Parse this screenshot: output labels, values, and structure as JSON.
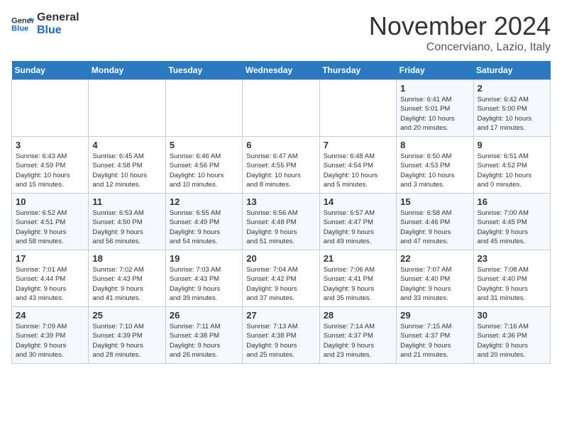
{
  "header": {
    "logo_line1": "General",
    "logo_line2": "Blue",
    "month": "November 2024",
    "location": "Concerviano, Lazio, Italy"
  },
  "days_of_week": [
    "Sunday",
    "Monday",
    "Tuesday",
    "Wednesday",
    "Thursday",
    "Friday",
    "Saturday"
  ],
  "weeks": [
    [
      {
        "day": "",
        "info": ""
      },
      {
        "day": "",
        "info": ""
      },
      {
        "day": "",
        "info": ""
      },
      {
        "day": "",
        "info": ""
      },
      {
        "day": "",
        "info": ""
      },
      {
        "day": "1",
        "info": "Sunrise: 6:41 AM\nSunset: 5:01 PM\nDaylight: 10 hours\nand 20 minutes."
      },
      {
        "day": "2",
        "info": "Sunrise: 6:42 AM\nSunset: 5:00 PM\nDaylight: 10 hours\nand 17 minutes."
      }
    ],
    [
      {
        "day": "3",
        "info": "Sunrise: 6:43 AM\nSunset: 4:59 PM\nDaylight: 10 hours\nand 15 minutes."
      },
      {
        "day": "4",
        "info": "Sunrise: 6:45 AM\nSunset: 4:58 PM\nDaylight: 10 hours\nand 12 minutes."
      },
      {
        "day": "5",
        "info": "Sunrise: 6:46 AM\nSunset: 4:56 PM\nDaylight: 10 hours\nand 10 minutes."
      },
      {
        "day": "6",
        "info": "Sunrise: 6:47 AM\nSunset: 4:55 PM\nDaylight: 10 hours\nand 8 minutes."
      },
      {
        "day": "7",
        "info": "Sunrise: 6:48 AM\nSunset: 4:54 PM\nDaylight: 10 hours\nand 5 minutes."
      },
      {
        "day": "8",
        "info": "Sunrise: 6:50 AM\nSunset: 4:53 PM\nDaylight: 10 hours\nand 3 minutes."
      },
      {
        "day": "9",
        "info": "Sunrise: 6:51 AM\nSunset: 4:52 PM\nDaylight: 10 hours\nand 0 minutes."
      }
    ],
    [
      {
        "day": "10",
        "info": "Sunrise: 6:52 AM\nSunset: 4:51 PM\nDaylight: 9 hours\nand 58 minutes."
      },
      {
        "day": "11",
        "info": "Sunrise: 6:53 AM\nSunset: 4:50 PM\nDaylight: 9 hours\nand 56 minutes."
      },
      {
        "day": "12",
        "info": "Sunrise: 6:55 AM\nSunset: 4:49 PM\nDaylight: 9 hours\nand 54 minutes."
      },
      {
        "day": "13",
        "info": "Sunrise: 6:56 AM\nSunset: 4:48 PM\nDaylight: 9 hours\nand 51 minutes."
      },
      {
        "day": "14",
        "info": "Sunrise: 6:57 AM\nSunset: 4:47 PM\nDaylight: 9 hours\nand 49 minutes."
      },
      {
        "day": "15",
        "info": "Sunrise: 6:58 AM\nSunset: 4:46 PM\nDaylight: 9 hours\nand 47 minutes."
      },
      {
        "day": "16",
        "info": "Sunrise: 7:00 AM\nSunset: 4:45 PM\nDaylight: 9 hours\nand 45 minutes."
      }
    ],
    [
      {
        "day": "17",
        "info": "Sunrise: 7:01 AM\nSunset: 4:44 PM\nDaylight: 9 hours\nand 43 minutes."
      },
      {
        "day": "18",
        "info": "Sunrise: 7:02 AM\nSunset: 4:43 PM\nDaylight: 9 hours\nand 41 minutes."
      },
      {
        "day": "19",
        "info": "Sunrise: 7:03 AM\nSunset: 4:43 PM\nDaylight: 9 hours\nand 39 minutes."
      },
      {
        "day": "20",
        "info": "Sunrise: 7:04 AM\nSunset: 4:42 PM\nDaylight: 9 hours\nand 37 minutes."
      },
      {
        "day": "21",
        "info": "Sunrise: 7:06 AM\nSunset: 4:41 PM\nDaylight: 9 hours\nand 35 minutes."
      },
      {
        "day": "22",
        "info": "Sunrise: 7:07 AM\nSunset: 4:40 PM\nDaylight: 9 hours\nand 33 minutes."
      },
      {
        "day": "23",
        "info": "Sunrise: 7:08 AM\nSunset: 4:40 PM\nDaylight: 9 hours\nand 31 minutes."
      }
    ],
    [
      {
        "day": "24",
        "info": "Sunrise: 7:09 AM\nSunset: 4:39 PM\nDaylight: 9 hours\nand 30 minutes."
      },
      {
        "day": "25",
        "info": "Sunrise: 7:10 AM\nSunset: 4:39 PM\nDaylight: 9 hours\nand 28 minutes."
      },
      {
        "day": "26",
        "info": "Sunrise: 7:11 AM\nSunset: 4:38 PM\nDaylight: 9 hours\nand 26 minutes."
      },
      {
        "day": "27",
        "info": "Sunrise: 7:13 AM\nSunset: 4:38 PM\nDaylight: 9 hours\nand 25 minutes."
      },
      {
        "day": "28",
        "info": "Sunrise: 7:14 AM\nSunset: 4:37 PM\nDaylight: 9 hours\nand 23 minutes."
      },
      {
        "day": "29",
        "info": "Sunrise: 7:15 AM\nSunset: 4:37 PM\nDaylight: 9 hours\nand 21 minutes."
      },
      {
        "day": "30",
        "info": "Sunrise: 7:16 AM\nSunset: 4:36 PM\nDaylight: 9 hours\nand 20 minutes."
      }
    ]
  ]
}
